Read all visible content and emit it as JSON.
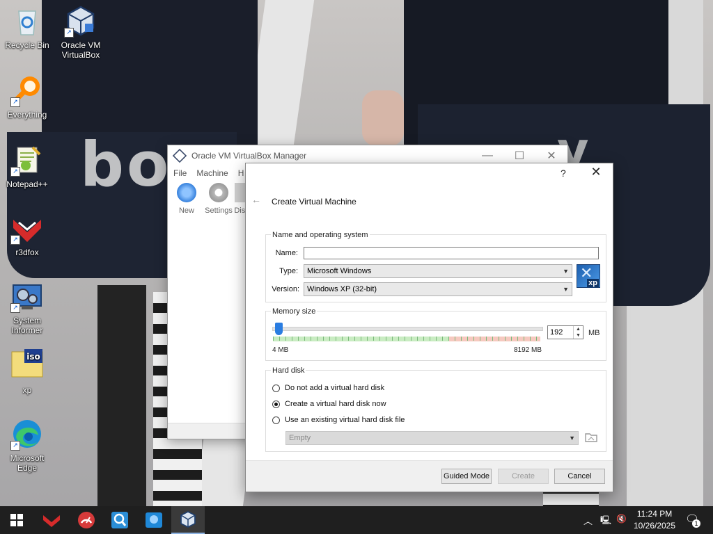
{
  "desktop": {
    "icons": [
      {
        "label": "Recycle Bin"
      },
      {
        "label": "Oracle VM VirtualBox"
      },
      {
        "label": "Everything"
      },
      {
        "label": "Notepad++"
      },
      {
        "label": "r3dfox"
      },
      {
        "label": "System Informer"
      },
      {
        "label": "xp"
      },
      {
        "label": "Microsoft Edge"
      }
    ],
    "wallpaper_text": "boy"
  },
  "manager": {
    "title": "Oracle VM VirtualBox Manager",
    "menu": [
      "File",
      "Machine",
      "H"
    ],
    "toolbar": [
      {
        "label": "New"
      },
      {
        "label": "Settings"
      },
      {
        "label": "Disc"
      }
    ]
  },
  "dialog": {
    "help_label": "?",
    "close_label": "✕",
    "back_label": "←",
    "heading": "Create Virtual Machine",
    "name_os": {
      "group_title": "Name and operating system",
      "name_label": "Name:",
      "name_value": "",
      "type_label": "Type:",
      "type_value": "Microsoft Windows",
      "version_label": "Version:",
      "version_value": "Windows XP (32-bit)",
      "os_badge": "xp"
    },
    "memory": {
      "group_title": "Memory size",
      "min_label": "4 MB",
      "max_label": "8192 MB",
      "value": "192",
      "unit": "MB",
      "fraction": 0.023
    },
    "hard_disk": {
      "group_title": "Hard disk",
      "options": [
        {
          "label": "Do not add a virtual hard disk",
          "selected": false
        },
        {
          "label": "Create a virtual hard disk now",
          "selected": true
        },
        {
          "label": "Use an existing virtual hard disk file",
          "selected": false
        }
      ],
      "existing_value": "Empty"
    },
    "buttons": {
      "guided": "Guided Mode",
      "create": "Create",
      "cancel": "Cancel"
    }
  },
  "taskbar": {
    "time": "11:24 PM",
    "date": "10/26/2025",
    "notification_count": "1"
  }
}
